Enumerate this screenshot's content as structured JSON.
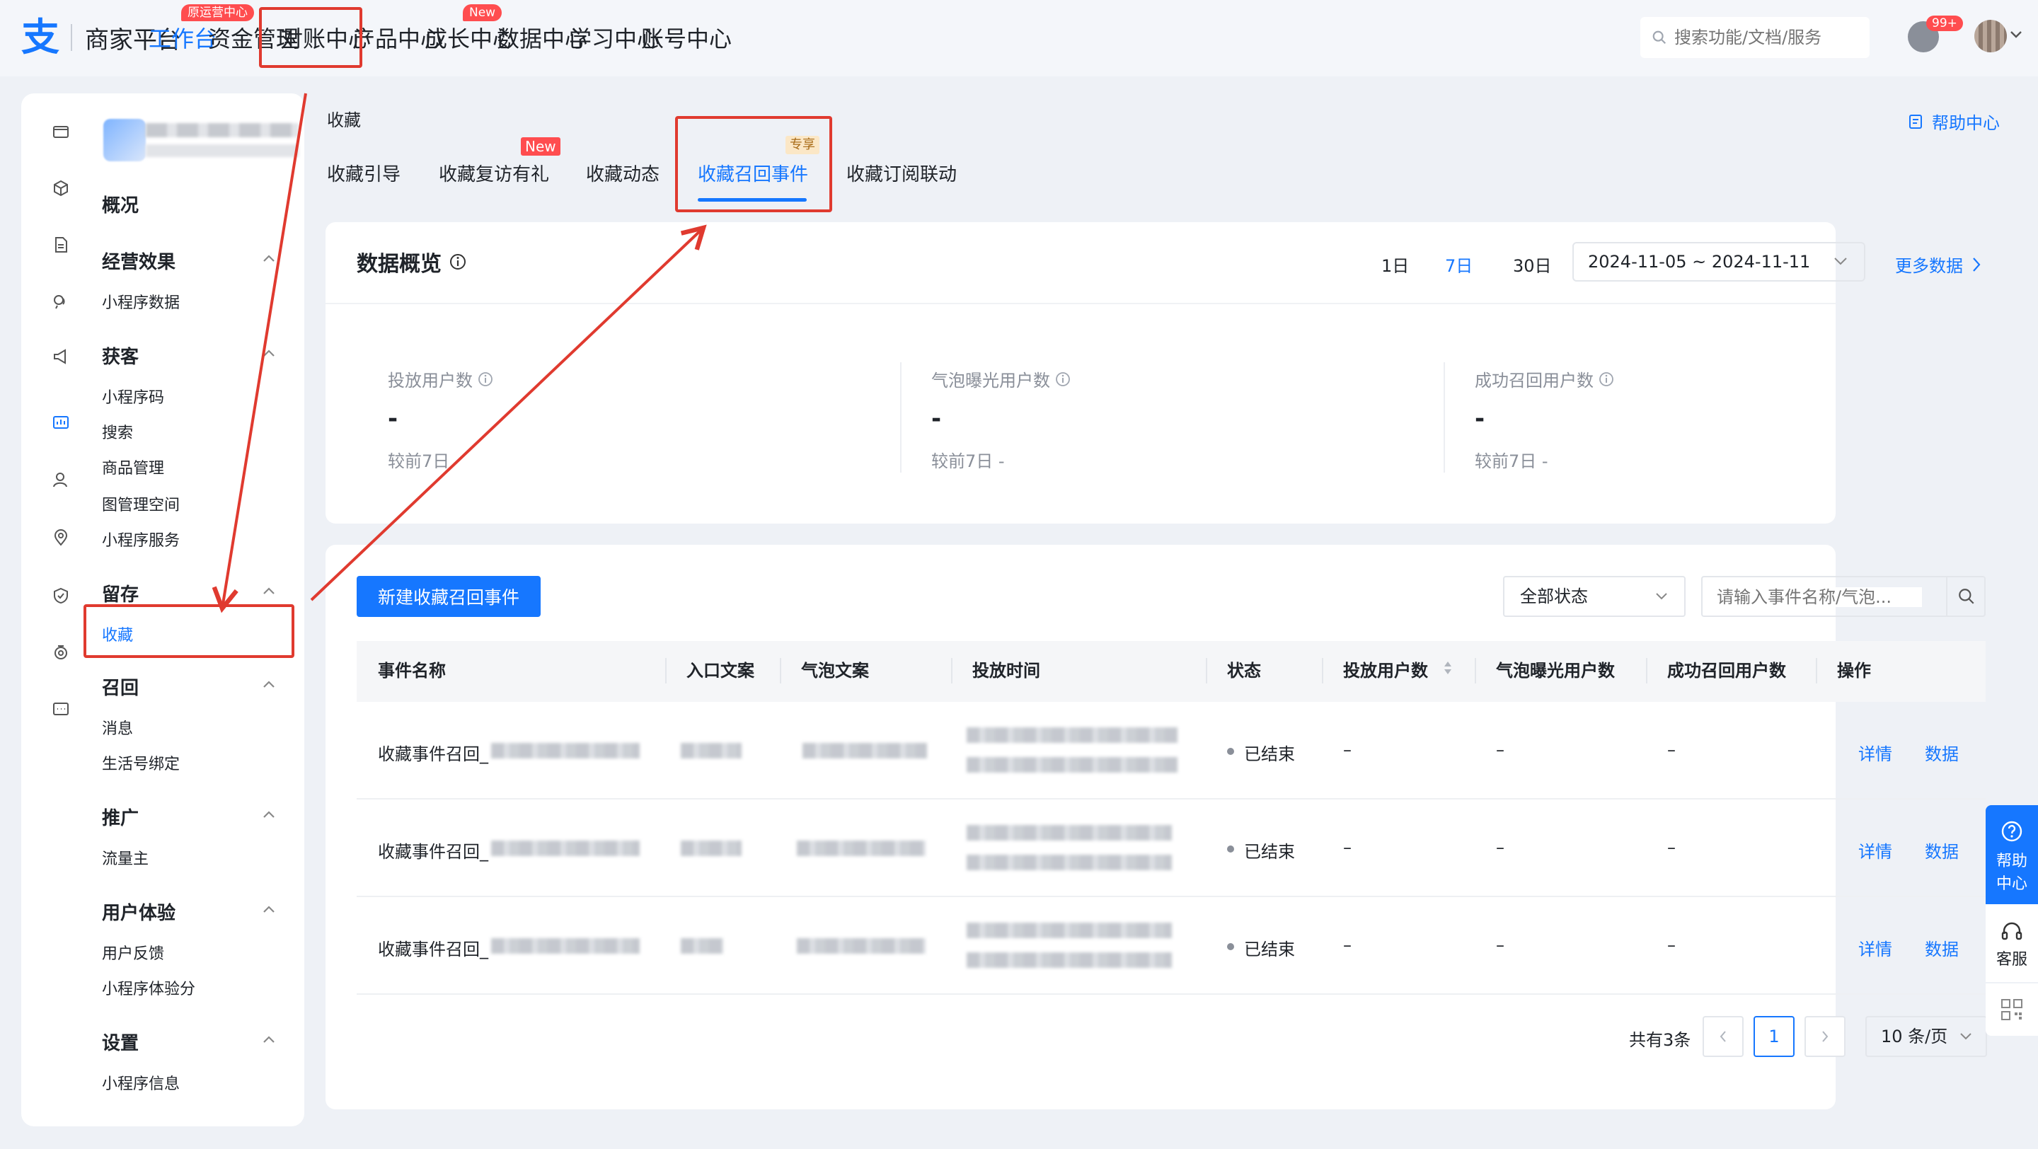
{
  "brand": {
    "name": "商家平台"
  },
  "topnav": {
    "items": [
      {
        "label": "工作台"
      },
      {
        "label": "资金管理"
      },
      {
        "label": "对账中心"
      },
      {
        "label": "产品中心"
      },
      {
        "label": "成长中心"
      },
      {
        "label": "数据中心"
      },
      {
        "label": "学习中心"
      },
      {
        "label": "账号中心"
      }
    ],
    "badge_workbench": "原运营中心",
    "badge_growth": "New",
    "search_placeholder": "搜索功能/文档/服务",
    "notification_count": "99+"
  },
  "sidebar": {
    "overview": "概况",
    "groups": [
      {
        "label": "经营效果",
        "items": [
          "小程序数据"
        ]
      },
      {
        "label": "获客",
        "items": [
          "小程序码",
          "搜索",
          "商品管理",
          "图管理空间",
          "小程序服务"
        ]
      },
      {
        "label": "留存",
        "items": [
          "收藏"
        ]
      },
      {
        "label": "召回",
        "items": [
          "消息",
          "生活号绑定"
        ]
      },
      {
        "label": "推广",
        "items": [
          "流量主"
        ]
      },
      {
        "label": "用户体验",
        "items": [
          "用户反馈",
          "小程序体验分"
        ]
      },
      {
        "label": "设置",
        "items": [
          "小程序信息"
        ]
      }
    ]
  },
  "page": {
    "breadcrumb": "收藏",
    "help_link": "帮助中心",
    "tabs": [
      "收藏引导",
      "收藏复访有礼",
      "收藏动态",
      "收藏召回事件",
      "收藏订阅联动"
    ],
    "tab_badge_new": "New",
    "tab_badge_pro": "专享"
  },
  "overview": {
    "title": "数据概览",
    "periods": [
      "1日",
      "7日",
      "30日"
    ],
    "active_period": "7日",
    "date_range": "2024-11-05 ~ 2024-11-11",
    "more_data": "更多数据",
    "metrics": [
      {
        "label": "投放用户数",
        "value": "-",
        "compare": "较前7日"
      },
      {
        "label": "气泡曝光用户数",
        "value": "-",
        "compare": "较前7日 -"
      },
      {
        "label": "成功召回用户数",
        "value": "-",
        "compare": "较前7日 -"
      }
    ]
  },
  "events": {
    "create_button": "新建收藏召回事件",
    "status_filter": "全部状态",
    "search_placeholder": "请输入事件名称/气泡...",
    "columns": [
      "事件名称",
      "入口文案",
      "气泡文案",
      "投放时间",
      "状态",
      "投放用户数",
      "气泡曝光用户数",
      "成功召回用户数",
      "操作"
    ],
    "rows": [
      {
        "name": "收藏事件召回_",
        "status": "已结束",
        "delivered": "–",
        "exposed": "–",
        "recalled": "–",
        "detail": "详情",
        "data": "数据"
      },
      {
        "name": "收藏事件召回_",
        "status": "已结束",
        "delivered": "–",
        "exposed": "–",
        "recalled": "–",
        "detail": "详情",
        "data": "数据"
      },
      {
        "name": "收藏事件召回_",
        "status": "已结束",
        "delivered": "–",
        "exposed": "–",
        "recalled": "–",
        "detail": "详情",
        "data": "数据"
      }
    ],
    "pagination": {
      "total": "共有3条",
      "current": "1",
      "page_size": "10 条/页"
    }
  },
  "float": {
    "help": "帮助中心",
    "service": "客服"
  },
  "colors": {
    "accent": "#1677ff",
    "highlight": "#e03a2f",
    "badge": "#ff4d4f"
  }
}
